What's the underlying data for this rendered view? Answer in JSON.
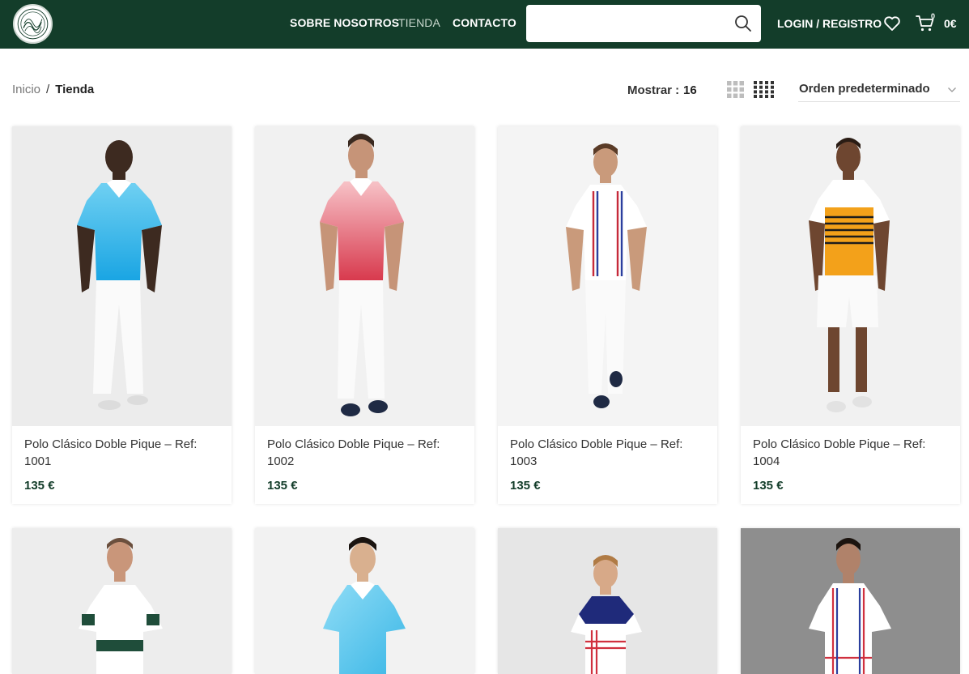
{
  "header": {
    "nav": [
      {
        "label": "SOBRE NOSOTROS",
        "active": false
      },
      {
        "label": "TIENDA",
        "active": true
      },
      {
        "label": "CONTACTO",
        "active": false
      }
    ],
    "search": {
      "placeholder": "",
      "value": ""
    },
    "login_label": "LOGIN / REGISTRO",
    "cart": {
      "count": "0",
      "total": "0€"
    }
  },
  "breadcrumb": {
    "home": "Inicio",
    "separator": "/",
    "current": "Tienda"
  },
  "toolbar": {
    "show_label": "Mostrar :",
    "show_value": "16",
    "sort_selected": "Orden predeterminado"
  },
  "products": [
    {
      "title": "Polo Clásico Doble Pique – Ref: 1001",
      "price": "135 €"
    },
    {
      "title": "Polo Clásico Doble Pique – Ref: 1002",
      "price": "135 €"
    },
    {
      "title": "Polo Clásico Doble Pique – Ref: 1003",
      "price": "135 €"
    },
    {
      "title": "Polo Clásico Doble Pique – Ref: 1004",
      "price": "135 €"
    }
  ],
  "colors": {
    "brand_green": "#133d2a",
    "price_green": "#133d2a",
    "text_dark": "#242424",
    "text_muted": "#767676"
  },
  "icons": [
    "search-icon",
    "heart-icon",
    "cart-icon",
    "grid-3-icon",
    "grid-4-icon",
    "chevron-down-icon"
  ]
}
